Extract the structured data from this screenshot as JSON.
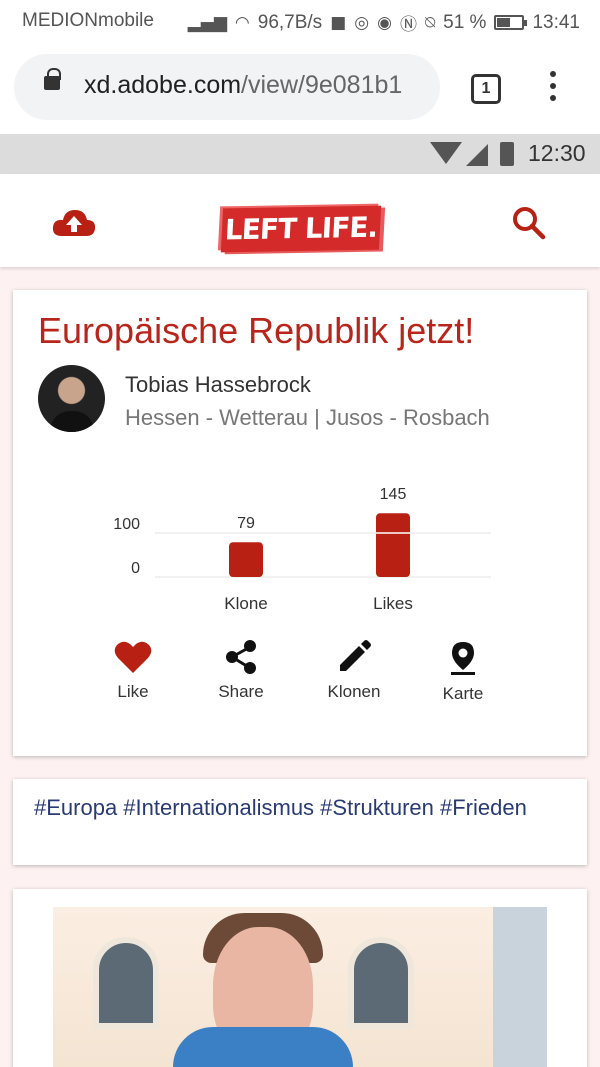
{
  "system_bar": {
    "carrier": "MEDIONmobile",
    "speed": "96,7B/s",
    "battery": "51 %",
    "time": "13:41",
    "icons": [
      "signal-icon",
      "wifi-icon",
      "square-icon",
      "instagram-icon",
      "eye-icon",
      "nfc-icon",
      "bell-off-icon",
      "battery-icon"
    ]
  },
  "browser": {
    "url_host": "xd.adobe.com",
    "url_path": "/view/9e081b1",
    "tab_count": "1"
  },
  "mockup_status": {
    "time": "12:30"
  },
  "header": {
    "logo": "LEFT LIFE."
  },
  "post": {
    "title": "Europäische Republik jetzt!",
    "author": "Tobias Hassebrock",
    "meta": "Hessen - Wetterau | Jusos - Rosbach",
    "actions": [
      {
        "label": "Like",
        "icon": "heart-icon"
      },
      {
        "label": "Share",
        "icon": "share-icon"
      },
      {
        "label": "Klonen",
        "icon": "pencil-icon"
      },
      {
        "label": "Karte",
        "icon": "map-pin-icon"
      }
    ]
  },
  "chart_data": {
    "type": "bar",
    "categories": [
      "Klone",
      "Likes"
    ],
    "values": [
      79,
      145
    ],
    "ytick_labels": [
      "0",
      "100"
    ],
    "ylim": [
      0,
      100
    ],
    "bar_color": "#b82014",
    "grid": true
  },
  "tags": "#Europa #Internationalismus #Strukturen #Frieden",
  "colors": {
    "accent": "#b8261b",
    "tag": "#2a3b73"
  }
}
